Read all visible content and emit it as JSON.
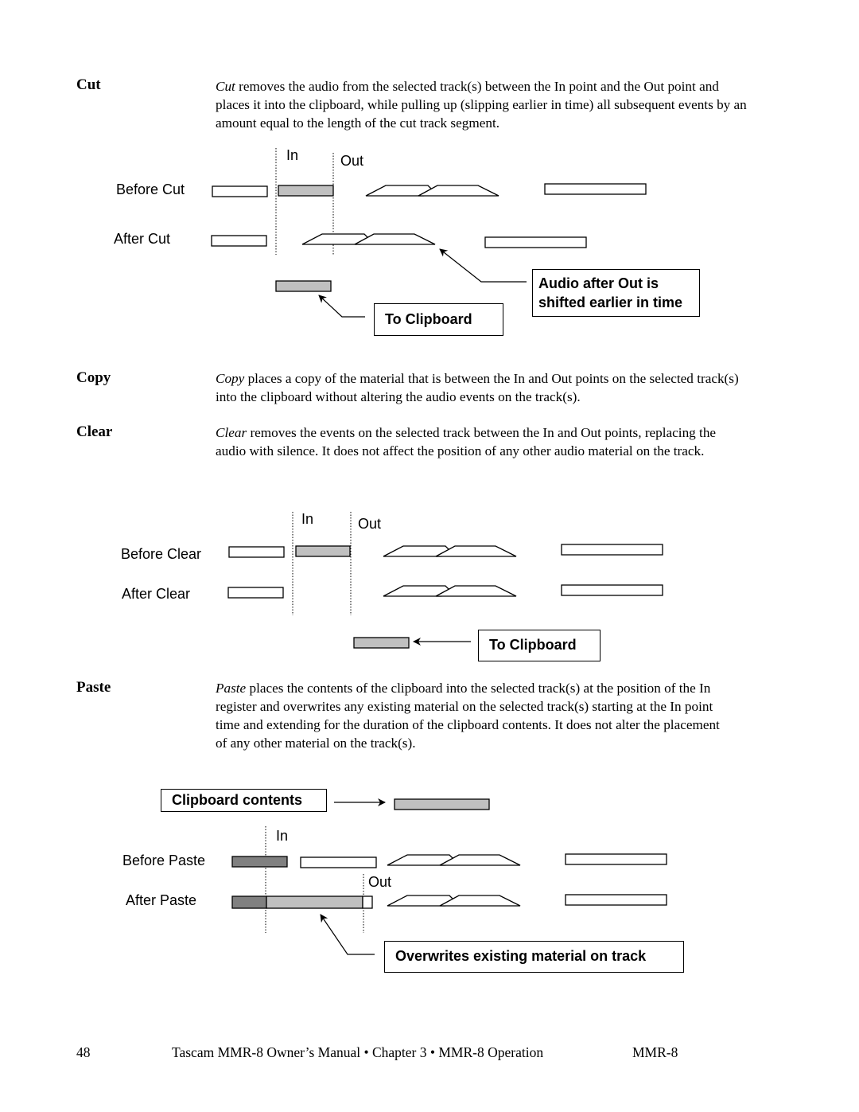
{
  "sections": {
    "cut": {
      "term": "Cut",
      "para_em": "Cut",
      "para_rest": " removes the audio from the selected track(s) between the In point and the Out point and places it into the clipboard, while pulling up (slipping earlier in time) all subsequent events by an amount equal to the length of the cut track segment."
    },
    "copy": {
      "term": "Copy",
      "para_em": "Copy",
      "para_rest": " places a copy of the material that is between the In and Out points on the selected track(s) into the clipboard without altering the audio events on the track(s)."
    },
    "clear": {
      "term": "Clear",
      "para_em": "Clear",
      "para_rest": " removes the events on the selected track between the In and Out points, replacing the audio with silence. It does not affect the position of any other audio material on the track."
    },
    "paste": {
      "term": "Paste",
      "para_em": "Paste",
      "para_rest": " places the contents of the clipboard into the selected track(s) at the position of the In register and overwrites any existing material on the selected track(s) starting at the In point time and extending for the duration of the clipboard contents. It does not alter the placement of any other material on the track(s)."
    }
  },
  "diagrams": {
    "cut": {
      "in_label": "In",
      "out_label": "Out",
      "row1_label": "Before Cut",
      "row2_label": "After Cut",
      "callout_shift": "Audio after Out is shifted earlier in time",
      "callout_shift_line1": "Audio after Out is",
      "callout_shift_line2": "shifted earlier in time",
      "callout_clipboard": "To Clipboard"
    },
    "clear": {
      "in_label": "In",
      "out_label": "Out",
      "row1_label": "Before Clear",
      "row2_label": "After Clear",
      "callout_clipboard": "To Clipboard"
    },
    "paste": {
      "clipboard_label": "Clipboard contents",
      "in_label": "In",
      "out_label": "Out",
      "row1_label": "Before Paste",
      "row2_label": "After Paste",
      "callout_overwrite": "Overwrites existing material on track"
    }
  },
  "colors": {
    "clip_fill": "#c0c0c0",
    "existing_fill": "#808080",
    "event_fill": "#ffffff",
    "stroke": "#000000"
  },
  "footer": {
    "page_number": "48",
    "title": "Tascam MMR-8 Owner’s Manual • Chapter 3 • MMR-8 Operation",
    "model": "MMR-8"
  }
}
